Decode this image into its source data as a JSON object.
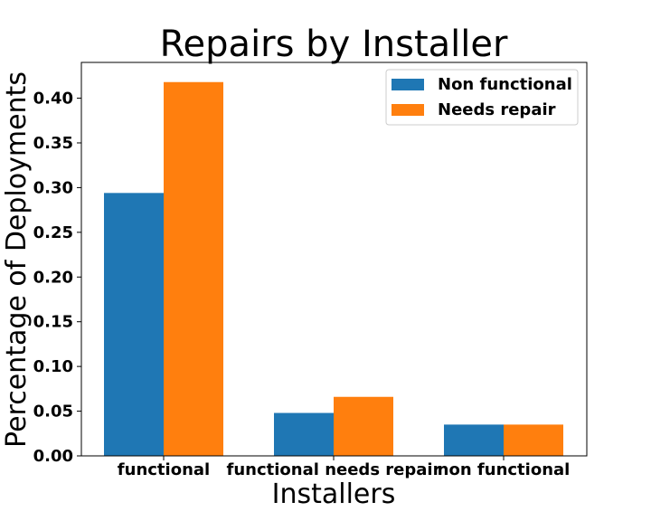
{
  "chart_data": {
    "type": "bar",
    "title": "Repairs by Installer",
    "xlabel": "Installers",
    "ylabel": "Percentage of Deployments",
    "categories": [
      "functional",
      "functional needs repair",
      "non functional"
    ],
    "series": [
      {
        "name": "Non functional",
        "color": "#1f77b4",
        "values": [
          0.294,
          0.048,
          0.035
        ]
      },
      {
        "name": "Needs repair",
        "color": "#ff7f0e",
        "values": [
          0.418,
          0.066,
          0.035
        ]
      }
    ],
    "ylim": [
      0,
      0.44
    ],
    "yticks": [
      "0.00",
      "0.05",
      "0.10",
      "0.15",
      "0.20",
      "0.25",
      "0.30",
      "0.35",
      "0.40"
    ],
    "legend_position": "top-right",
    "grid": false
  }
}
